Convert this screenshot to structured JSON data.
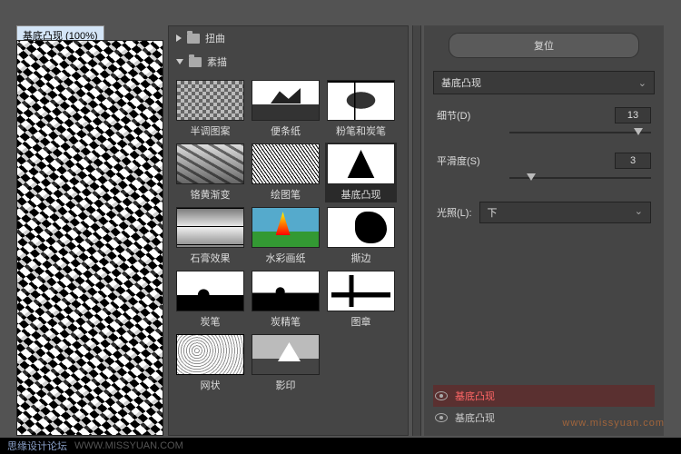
{
  "preview": {
    "title": "基底凸现 (100%)"
  },
  "categories": {
    "collapsed": {
      "label": "扭曲"
    },
    "expanded": {
      "label": "素描"
    }
  },
  "thumbs": [
    {
      "label": "半调图案"
    },
    {
      "label": "便条纸"
    },
    {
      "label": "粉笔和炭笔"
    },
    {
      "label": "铬黄渐变"
    },
    {
      "label": "绘图笔"
    },
    {
      "label": "基底凸现"
    },
    {
      "label": "石膏效果"
    },
    {
      "label": "水彩画纸"
    },
    {
      "label": "撕边"
    },
    {
      "label": "炭笔"
    },
    {
      "label": "炭精笔"
    },
    {
      "label": "图章"
    },
    {
      "label": "网状"
    },
    {
      "label": "影印"
    }
  ],
  "controls": {
    "reset": "复位",
    "preset": "基底凸现",
    "detail": {
      "label": "细节(D)",
      "value": "13",
      "pos": 88
    },
    "smooth": {
      "label": "平滑度(S)",
      "value": "3",
      "pos": 12
    },
    "light": {
      "label": "光照(L):",
      "value": "下"
    }
  },
  "fx": {
    "row1": "基底凸现",
    "row2": "基底凸现"
  },
  "watermark": "www.missyuan.com",
  "footer": {
    "main": "思缘设计论坛",
    "sub": "WWW.MISSYUAN.COM"
  }
}
